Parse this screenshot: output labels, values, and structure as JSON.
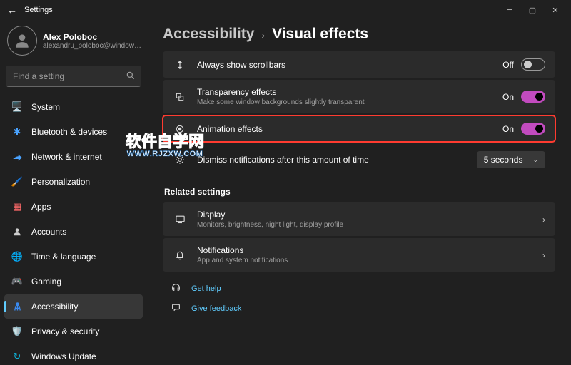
{
  "window": {
    "title": "Settings"
  },
  "profile": {
    "name": "Alex Poloboc",
    "email": "alexandru_poloboc@windowsreport..."
  },
  "search": {
    "placeholder": "Find a setting"
  },
  "nav": [
    {
      "label": "System",
      "icon": "🖥️",
      "color": "#4aa3ff"
    },
    {
      "label": "Bluetooth & devices",
      "icon": "✱",
      "color": "#4aa3ff"
    },
    {
      "label": "Network & internet",
      "icon": null,
      "color": "#4aa3ff"
    },
    {
      "label": "Personalization",
      "icon": "🖌️",
      "color": "#e08030"
    },
    {
      "label": "Apps",
      "icon": "▦",
      "color": "#ff6a6a"
    },
    {
      "label": "Accounts",
      "icon": null,
      "color": "#8a8a8a"
    },
    {
      "label": "Time & language",
      "icon": "🌐",
      "color": "#4aa3ff"
    },
    {
      "label": "Gaming",
      "icon": "🎮",
      "color": "#7a7a7a"
    },
    {
      "label": "Accessibility",
      "icon": null,
      "color": "#3a8af0",
      "selected": true
    },
    {
      "label": "Privacy & security",
      "icon": "🛡️",
      "color": "#8a8a8a"
    },
    {
      "label": "Windows Update",
      "icon": "↻",
      "color": "#0fb1d6"
    }
  ],
  "breadcrumb": {
    "parent": "Accessibility",
    "current": "Visual effects"
  },
  "settings": {
    "scrollbars": {
      "label": "Always show scrollbars",
      "state": "Off"
    },
    "transparency": {
      "label": "Transparency effects",
      "sub": "Make some window backgrounds slightly transparent",
      "state": "On"
    },
    "animation": {
      "label": "Animation effects",
      "state": "On"
    },
    "dismiss": {
      "label": "Dismiss notifications after this amount of time",
      "value": "5 seconds"
    }
  },
  "related": {
    "title": "Related settings",
    "display": {
      "label": "Display",
      "sub": "Monitors, brightness, night light, display profile"
    },
    "notifications": {
      "label": "Notifications",
      "sub": "App and system notifications"
    }
  },
  "footer": {
    "help": "Get help",
    "feedback": "Give feedback"
  },
  "overlay": {
    "line1": "软件自学网",
    "line2": "WWW.RJZXW.COM"
  }
}
